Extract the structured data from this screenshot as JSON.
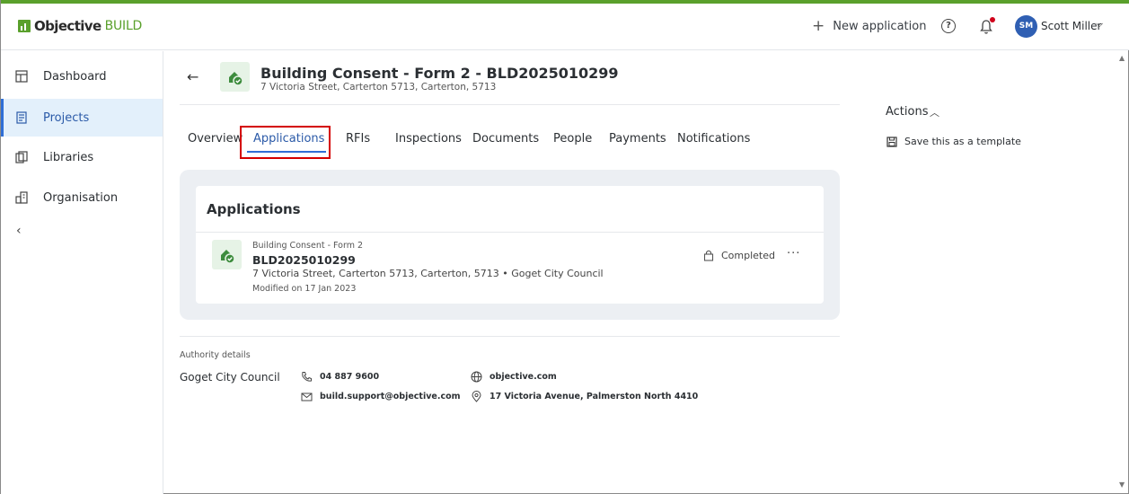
{
  "app": {
    "brand_bold": "Objective",
    "brand_light": "BUILD"
  },
  "header": {
    "new_application_label": "New application",
    "user_initials": "SM",
    "user_name": "Scott Miller",
    "icons": [
      "plus-icon",
      "help-icon",
      "bell-icon",
      "chevron-down-icon"
    ]
  },
  "sidebar": {
    "items": [
      {
        "label": "Dashboard",
        "icon": "dashboard-icon",
        "active": false
      },
      {
        "label": "Projects",
        "icon": "projects-icon",
        "active": true
      },
      {
        "label": "Libraries",
        "icon": "libraries-icon",
        "active": false
      },
      {
        "label": "Organisation",
        "icon": "organisation-icon",
        "active": false
      }
    ],
    "collapse_glyph": "‹"
  },
  "project": {
    "title": "Building Consent - Form 2 - BLD2025010299",
    "subtitle": "7 Victoria Street, Carterton 5713, Carterton, 5713"
  },
  "tabs": [
    {
      "label": "Overview"
    },
    {
      "label": "Applications",
      "active": true
    },
    {
      "label": "RFIs"
    },
    {
      "label": "Inspections"
    },
    {
      "label": "Documents"
    },
    {
      "label": "People"
    },
    {
      "label": "Payments"
    },
    {
      "label": "Notifications"
    }
  ],
  "applications_panel": {
    "heading": "Applications",
    "item": {
      "type": "Building Consent - Form 2",
      "id": "BLD2025010299",
      "address": "7 Victoria Street, Carterton 5713, Carterton, 5713 • Goget City Council",
      "modified": "Modified on 17 Jan 2023",
      "status": "Completed",
      "more_glyph": "···"
    }
  },
  "authority": {
    "label": "Authority details",
    "name": "Goget City Council",
    "phone": "04 887 9600",
    "email": "build.support@objective.com",
    "website": "objective.com",
    "address": "17 Victoria Avenue, Palmerston North 4410"
  },
  "actions": {
    "title": "Actions",
    "save_template": "Save this as a template"
  },
  "colors": {
    "brand_green": "#5aa02c",
    "active_blue": "#2f6fd6",
    "highlight_red": "#d40000",
    "notification_red": "#d0021b",
    "avatar_blue": "#2f5fb3"
  }
}
